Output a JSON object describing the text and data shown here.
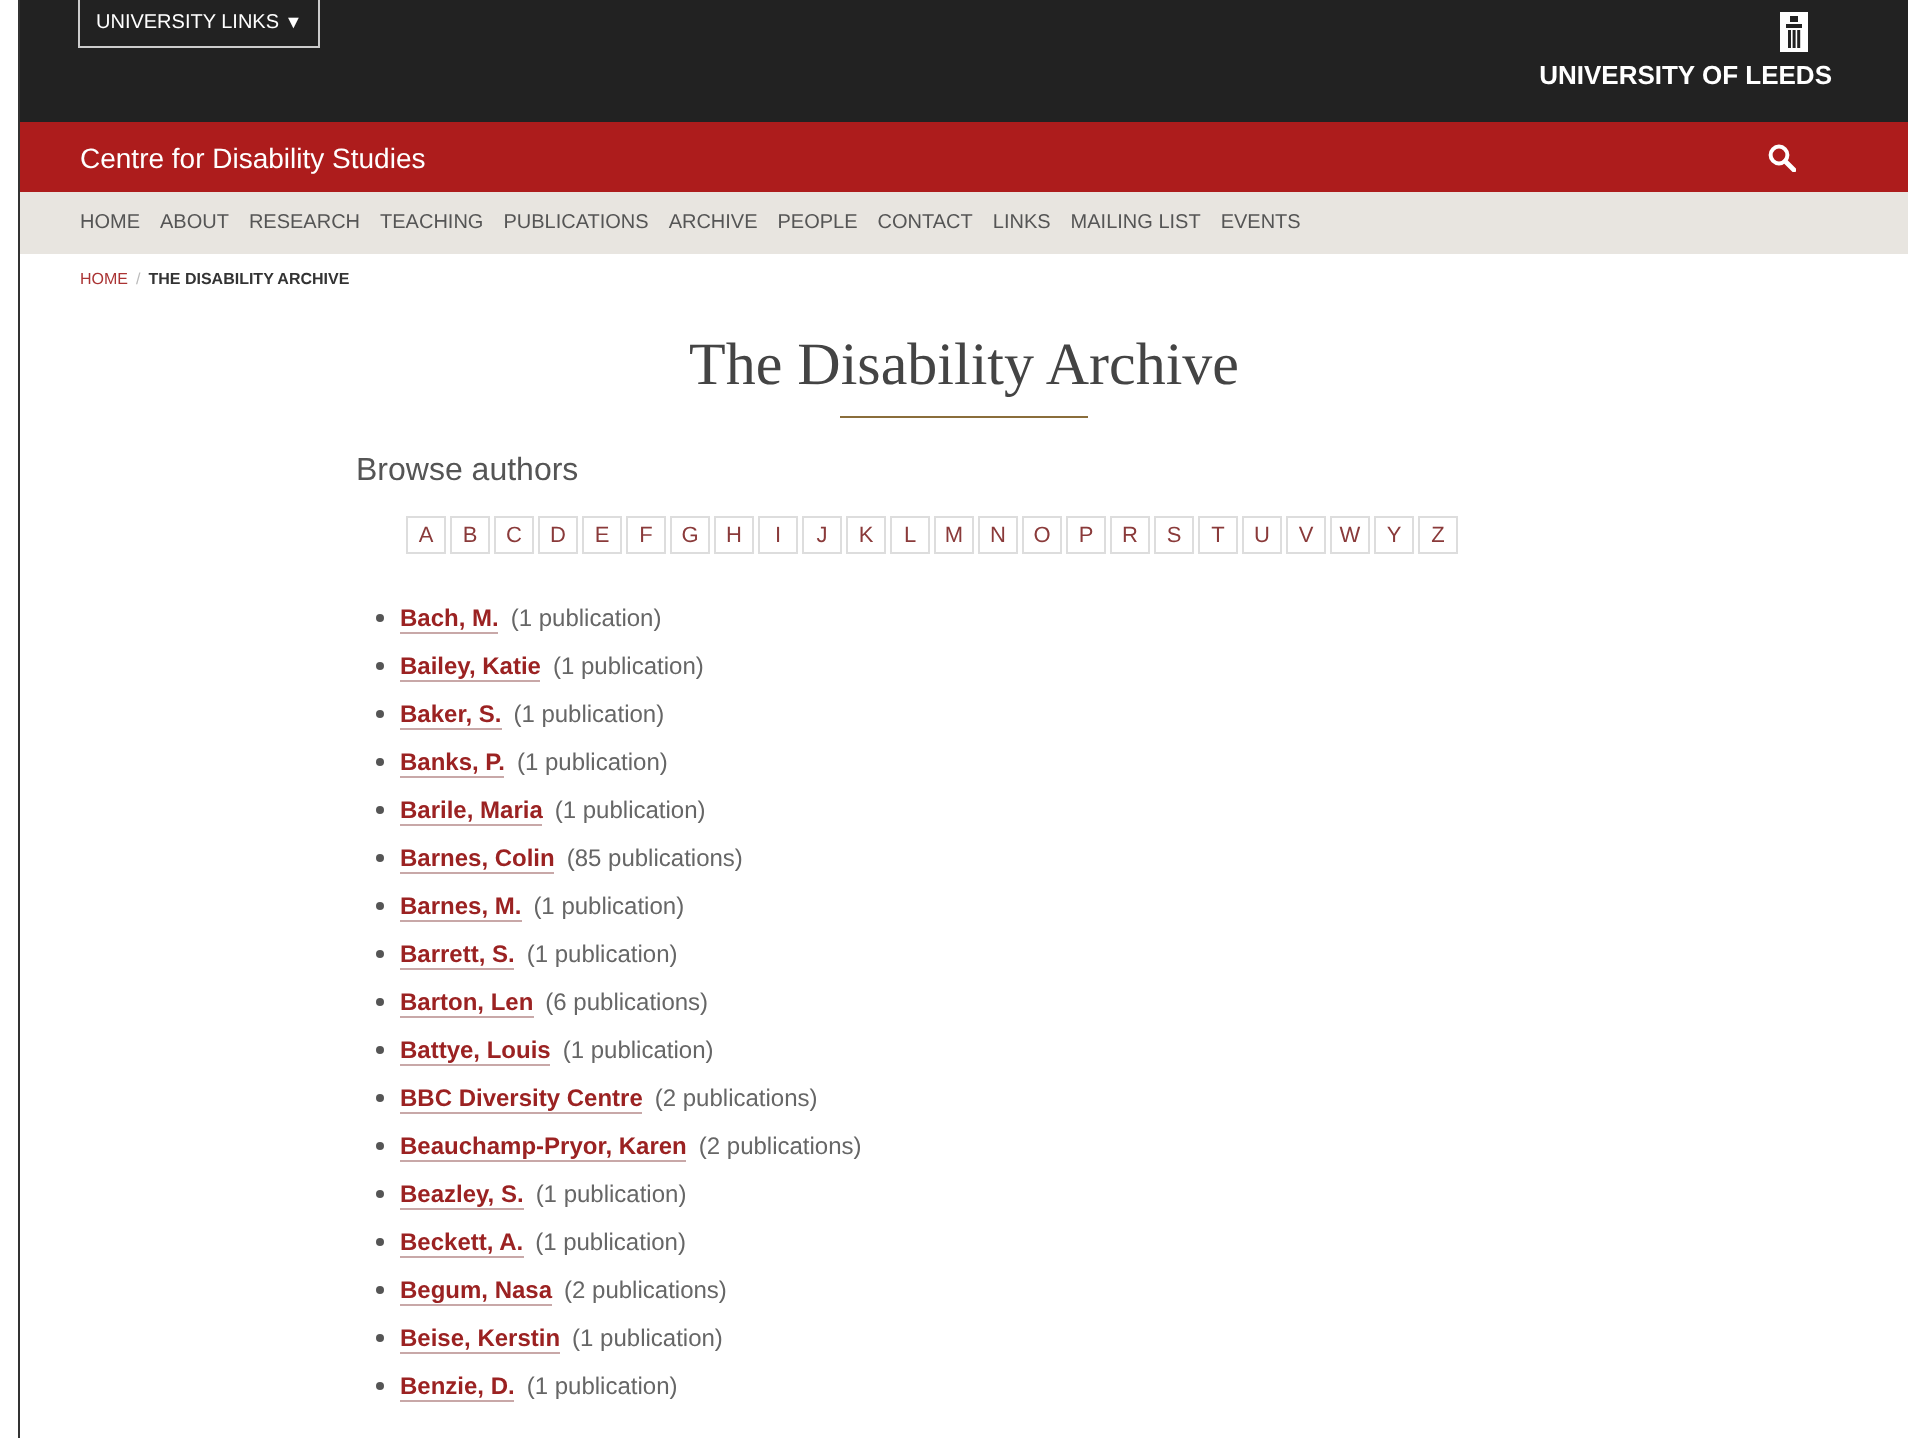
{
  "top_bar": {
    "links_button": "UNIVERSITY LINKS",
    "links_caret": "▼",
    "logo_text": "UNIVERSITY OF LEEDS"
  },
  "site_bar": {
    "title": "Centre for Disability Studies"
  },
  "nav": [
    "HOME",
    "ABOUT",
    "RESEARCH",
    "TEACHING",
    "PUBLICATIONS",
    "ARCHIVE",
    "PEOPLE",
    "CONTACT",
    "LINKS",
    "MAILING LIST",
    "EVENTS"
  ],
  "breadcrumb": {
    "home": "HOME",
    "separator": "/",
    "current": "THE DISABILITY ARCHIVE"
  },
  "page_title": "The Disability Archive",
  "browse_heading": "Browse authors",
  "letters": [
    "A",
    "B",
    "C",
    "D",
    "E",
    "F",
    "G",
    "H",
    "I",
    "J",
    "K",
    "L",
    "M",
    "N",
    "O",
    "P",
    "R",
    "S",
    "T",
    "U",
    "V",
    "W",
    "Y",
    "Z"
  ],
  "authors": [
    {
      "name": "Bach, M.",
      "count": "(1 publication)"
    },
    {
      "name": "Bailey, Katie",
      "count": "(1 publication)"
    },
    {
      "name": "Baker, S.",
      "count": "(1 publication)"
    },
    {
      "name": "Banks, P.",
      "count": "(1 publication)"
    },
    {
      "name": "Barile, Maria",
      "count": "(1 publication)"
    },
    {
      "name": "Barnes, Colin",
      "count": "(85 publications)"
    },
    {
      "name": "Barnes, M.",
      "count": "(1 publication)"
    },
    {
      "name": "Barrett, S.",
      "count": "(1 publication)"
    },
    {
      "name": "Barton, Len",
      "count": "(6 publications)"
    },
    {
      "name": "Battye, Louis",
      "count": "(1 publication)"
    },
    {
      "name": "BBC Diversity Centre",
      "count": "(2 publications)"
    },
    {
      "name": "Beauchamp-Pryor, Karen",
      "count": "(2 publications)"
    },
    {
      "name": "Beazley, S.",
      "count": "(1 publication)"
    },
    {
      "name": "Beckett, A.",
      "count": "(1 publication)"
    },
    {
      "name": "Begum, Nasa",
      "count": "(2 publications)"
    },
    {
      "name": "Beise, Kerstin",
      "count": "(1 publication)"
    },
    {
      "name": "Benzie, D.",
      "count": "(1 publication)"
    }
  ]
}
